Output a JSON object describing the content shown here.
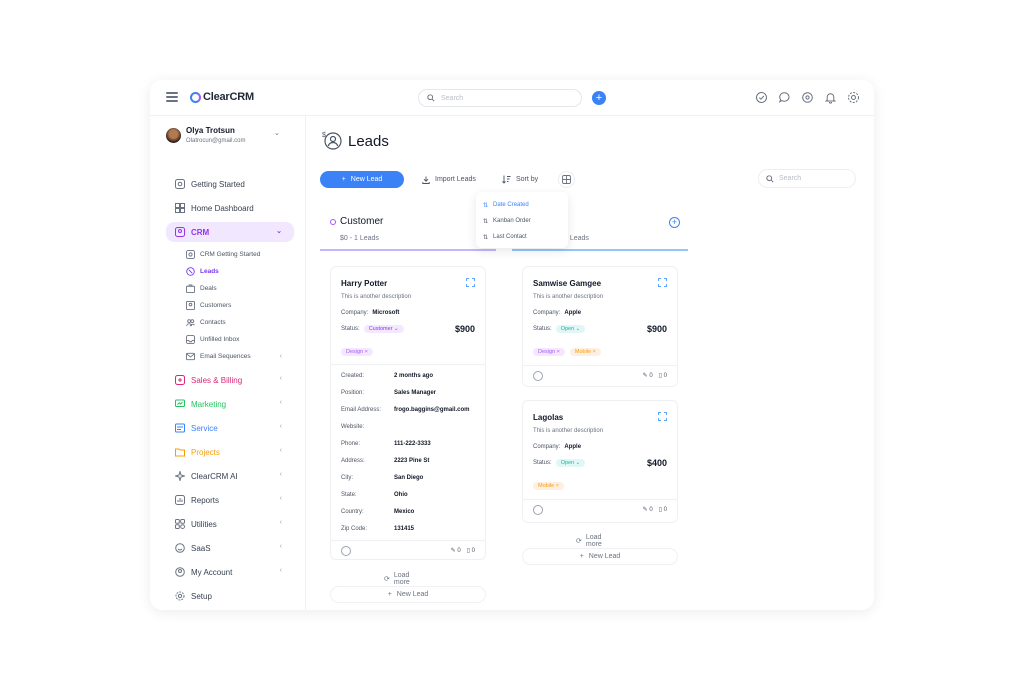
{
  "app": {
    "logo_text": "ClearCRM"
  },
  "topbar": {
    "search_placeholder": "Search",
    "add_label": "+"
  },
  "user": {
    "name": "Olya Trotsun",
    "email": "Olatrocun@gmail.com"
  },
  "nav": {
    "getting_started": "Getting Started",
    "home_dashboard": "Home Dashboard",
    "crm": "CRM",
    "crm_sub": [
      "CRM Getting Started",
      "Leads",
      "Deals",
      "Customers",
      "Contacts",
      "Unfilled Inbox",
      "Email Sequences"
    ],
    "sales_billing": "Sales & Billing",
    "marketing": "Marketing",
    "service": "Service",
    "projects": "Projects",
    "ai": "ClearCRM AI",
    "reports": "Reports",
    "utilities": "Utilities",
    "saas": "SaaS",
    "my_account": "My Account",
    "setup": "Setup"
  },
  "colors": {
    "accent": "#3b82f6",
    "crm": "#9333ea",
    "sales": "#db2777",
    "marketing": "#22c55e",
    "service": "#3b82f6",
    "projects": "#f59e0b"
  },
  "page": {
    "title": "Leads"
  },
  "toolbar": {
    "new_lead": "New Lead",
    "import": "Import Leads",
    "sort": "Sort by",
    "search_placeholder": "Search",
    "sort_options": [
      "Date Created",
      "Kanban Order",
      "Last Contact"
    ],
    "sort_selected": "Date Created"
  },
  "columns": [
    {
      "title": "Customer",
      "subtitle": "$0 - 1 Leads"
    },
    {
      "title": "",
      "subtitle": "3 Leads"
    }
  ],
  "cards": {
    "harry": {
      "name": "Harry Potter",
      "description": "This is another description",
      "company_label": "Company:",
      "company": "Microsoft",
      "status_label": "Status:",
      "status": "Customer",
      "price": "$900",
      "tags": [
        "Design"
      ],
      "details": [
        {
          "k": "Created:",
          "v": "2 months ago"
        },
        {
          "k": "Position:",
          "v": "Sales Manager"
        },
        {
          "k": "Email Address:",
          "v": "frogo.baggins@gmail.com"
        },
        {
          "k": "Website:",
          "v": ""
        },
        {
          "k": "Phone:",
          "v": "111-222-3333"
        },
        {
          "k": "Address:",
          "v": "2223 Pine St"
        },
        {
          "k": "City:",
          "v": "San Diego"
        },
        {
          "k": "State:",
          "v": "Ohio"
        },
        {
          "k": "Country:",
          "v": "Mexico"
        },
        {
          "k": "Zip Code:",
          "v": "131415"
        }
      ],
      "notes_count": "0",
      "files_count": "0"
    },
    "samwise": {
      "name": "Samwise Gamgee",
      "description": "This is another description",
      "company_label": "Company:",
      "company": "Apple",
      "status_label": "Status:",
      "status": "Open",
      "price": "$900",
      "tags": [
        "Design",
        "Mobile"
      ],
      "notes_count": "0",
      "files_count": "0"
    },
    "lagolas": {
      "name": "Lagolas",
      "description": "This is another description",
      "company_label": "Company:",
      "company": "Apple",
      "status_label": "Status:",
      "status": "Open",
      "price": "$400",
      "tags": [
        "Mobile"
      ],
      "notes_count": "0",
      "files_count": "0"
    }
  },
  "column_actions": {
    "load_more": "Load more",
    "new_lead": "New Lead"
  }
}
